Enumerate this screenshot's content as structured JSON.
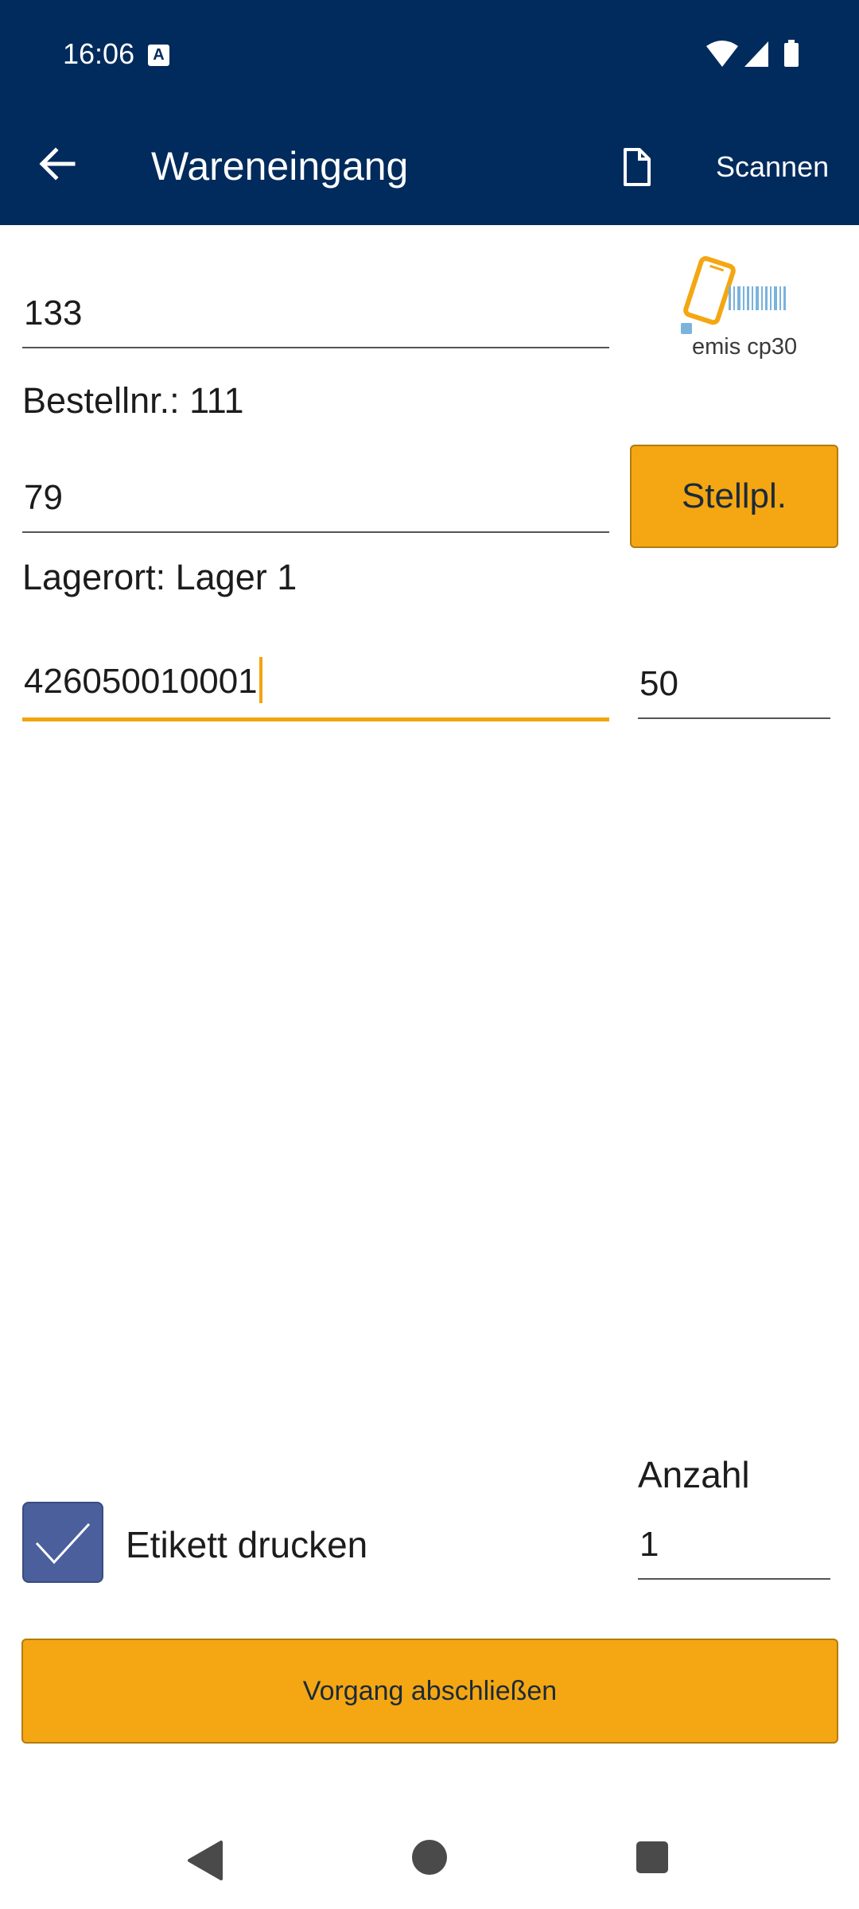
{
  "status_bar": {
    "time": "16:06",
    "notification_icon": "a-icon"
  },
  "app_bar": {
    "title": "Wareneingang",
    "back_icon": "arrow-back-icon",
    "document_icon": "document-icon",
    "scan_label": "Scannen",
    "background": "#002b5c"
  },
  "form": {
    "order_field": {
      "value": "133"
    },
    "order_info": "Bestellnr.: 111",
    "location_field": {
      "value": "79"
    },
    "location_button": "Stellpl.",
    "location_info": "Lagerort: Lager 1",
    "ean_field": {
      "value": "426050010001"
    },
    "quantity_field": {
      "value": "50"
    }
  },
  "logo": {
    "text": "emis cp30"
  },
  "print_options": {
    "print_label": "Etikett drucken",
    "print_checked": true,
    "count_label": "Anzahl",
    "count_value": "1"
  },
  "actions": {
    "finish_label": "Vorgang abschließen"
  },
  "colors": {
    "accent": "#f4a712",
    "checkbox": "#4a5f9c",
    "primary": "#002b5c"
  }
}
